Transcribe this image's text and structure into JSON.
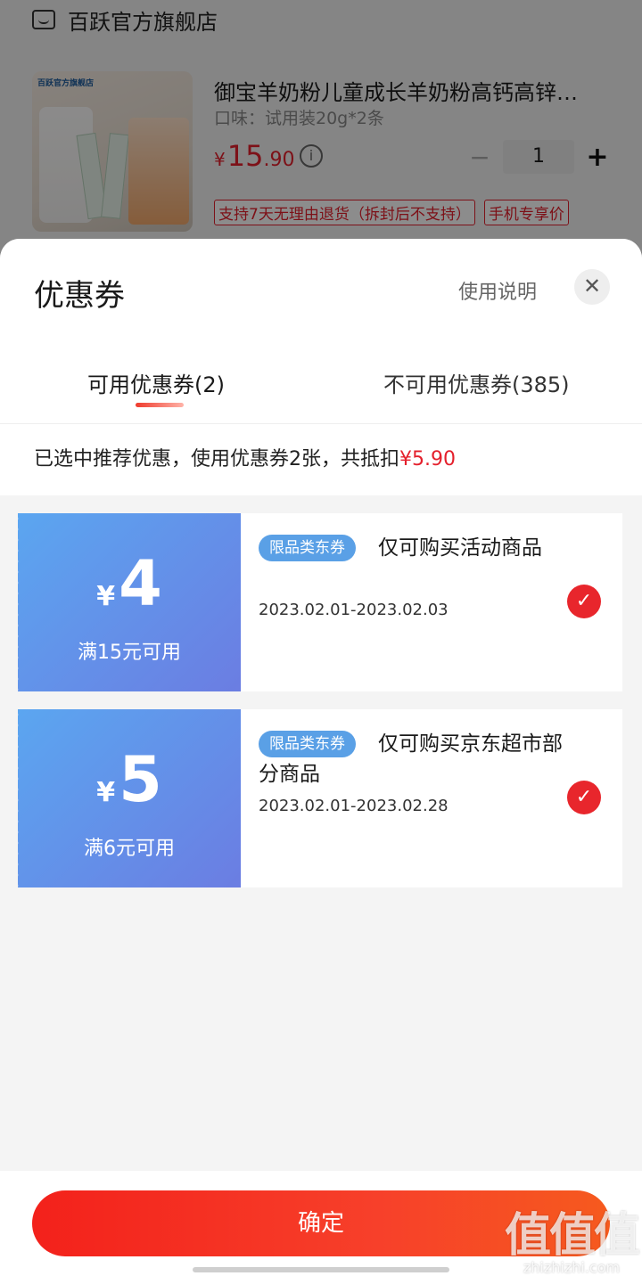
{
  "background": {
    "store_name": "百跃官方旗舰店",
    "product": {
      "image_logo": "百跃官方旗舰店",
      "title": "御宝羊奶粉儿童成长羊奶粉高钙高锌…",
      "spec": "口味：试用装20g*2条",
      "price_symbol": "¥",
      "price_int": "15",
      "price_dec": ".90",
      "quantity": "1",
      "minus_label": "−",
      "plus_label": "+",
      "info_icon": "i",
      "tags": [
        "支持7天无理由退货（拆封后不支持）",
        "手机专享价"
      ]
    }
  },
  "sheet": {
    "title": "优惠券",
    "usage_link": "使用说明",
    "close_icon": "✕",
    "tabs": [
      {
        "label": "可用优惠券(2)",
        "active": true
      },
      {
        "label": "不可用优惠券(385)",
        "active": false
      }
    ],
    "summary": {
      "text": "已选中推荐优惠，使用优惠券2张，共抵扣",
      "amount": "¥5.90"
    },
    "coupons": [
      {
        "currency": "¥",
        "amount": "4",
        "condition": "满15元可用",
        "badge": "限品类东券",
        "description": "仅可购买活动商品",
        "validity": "2023.02.01-2023.02.03",
        "selected": true,
        "check_icon": "✓"
      },
      {
        "currency": "¥",
        "amount": "5",
        "condition": "满6元可用",
        "badge": "限品类东券",
        "description": "仅可购买京东超市部分商品",
        "validity": "2023.02.01-2023.02.28",
        "selected": true,
        "check_icon": "✓"
      }
    ],
    "confirm_label": "确定"
  },
  "watermark": {
    "main": "值值值",
    "sub": "zhizhizhi.com"
  },
  "colors": {
    "accent_red": "#e4202c",
    "coupon_blue_start": "#5ba6f0",
    "coupon_blue_end": "#6b7de2",
    "badge_blue": "#5aa0e6"
  }
}
